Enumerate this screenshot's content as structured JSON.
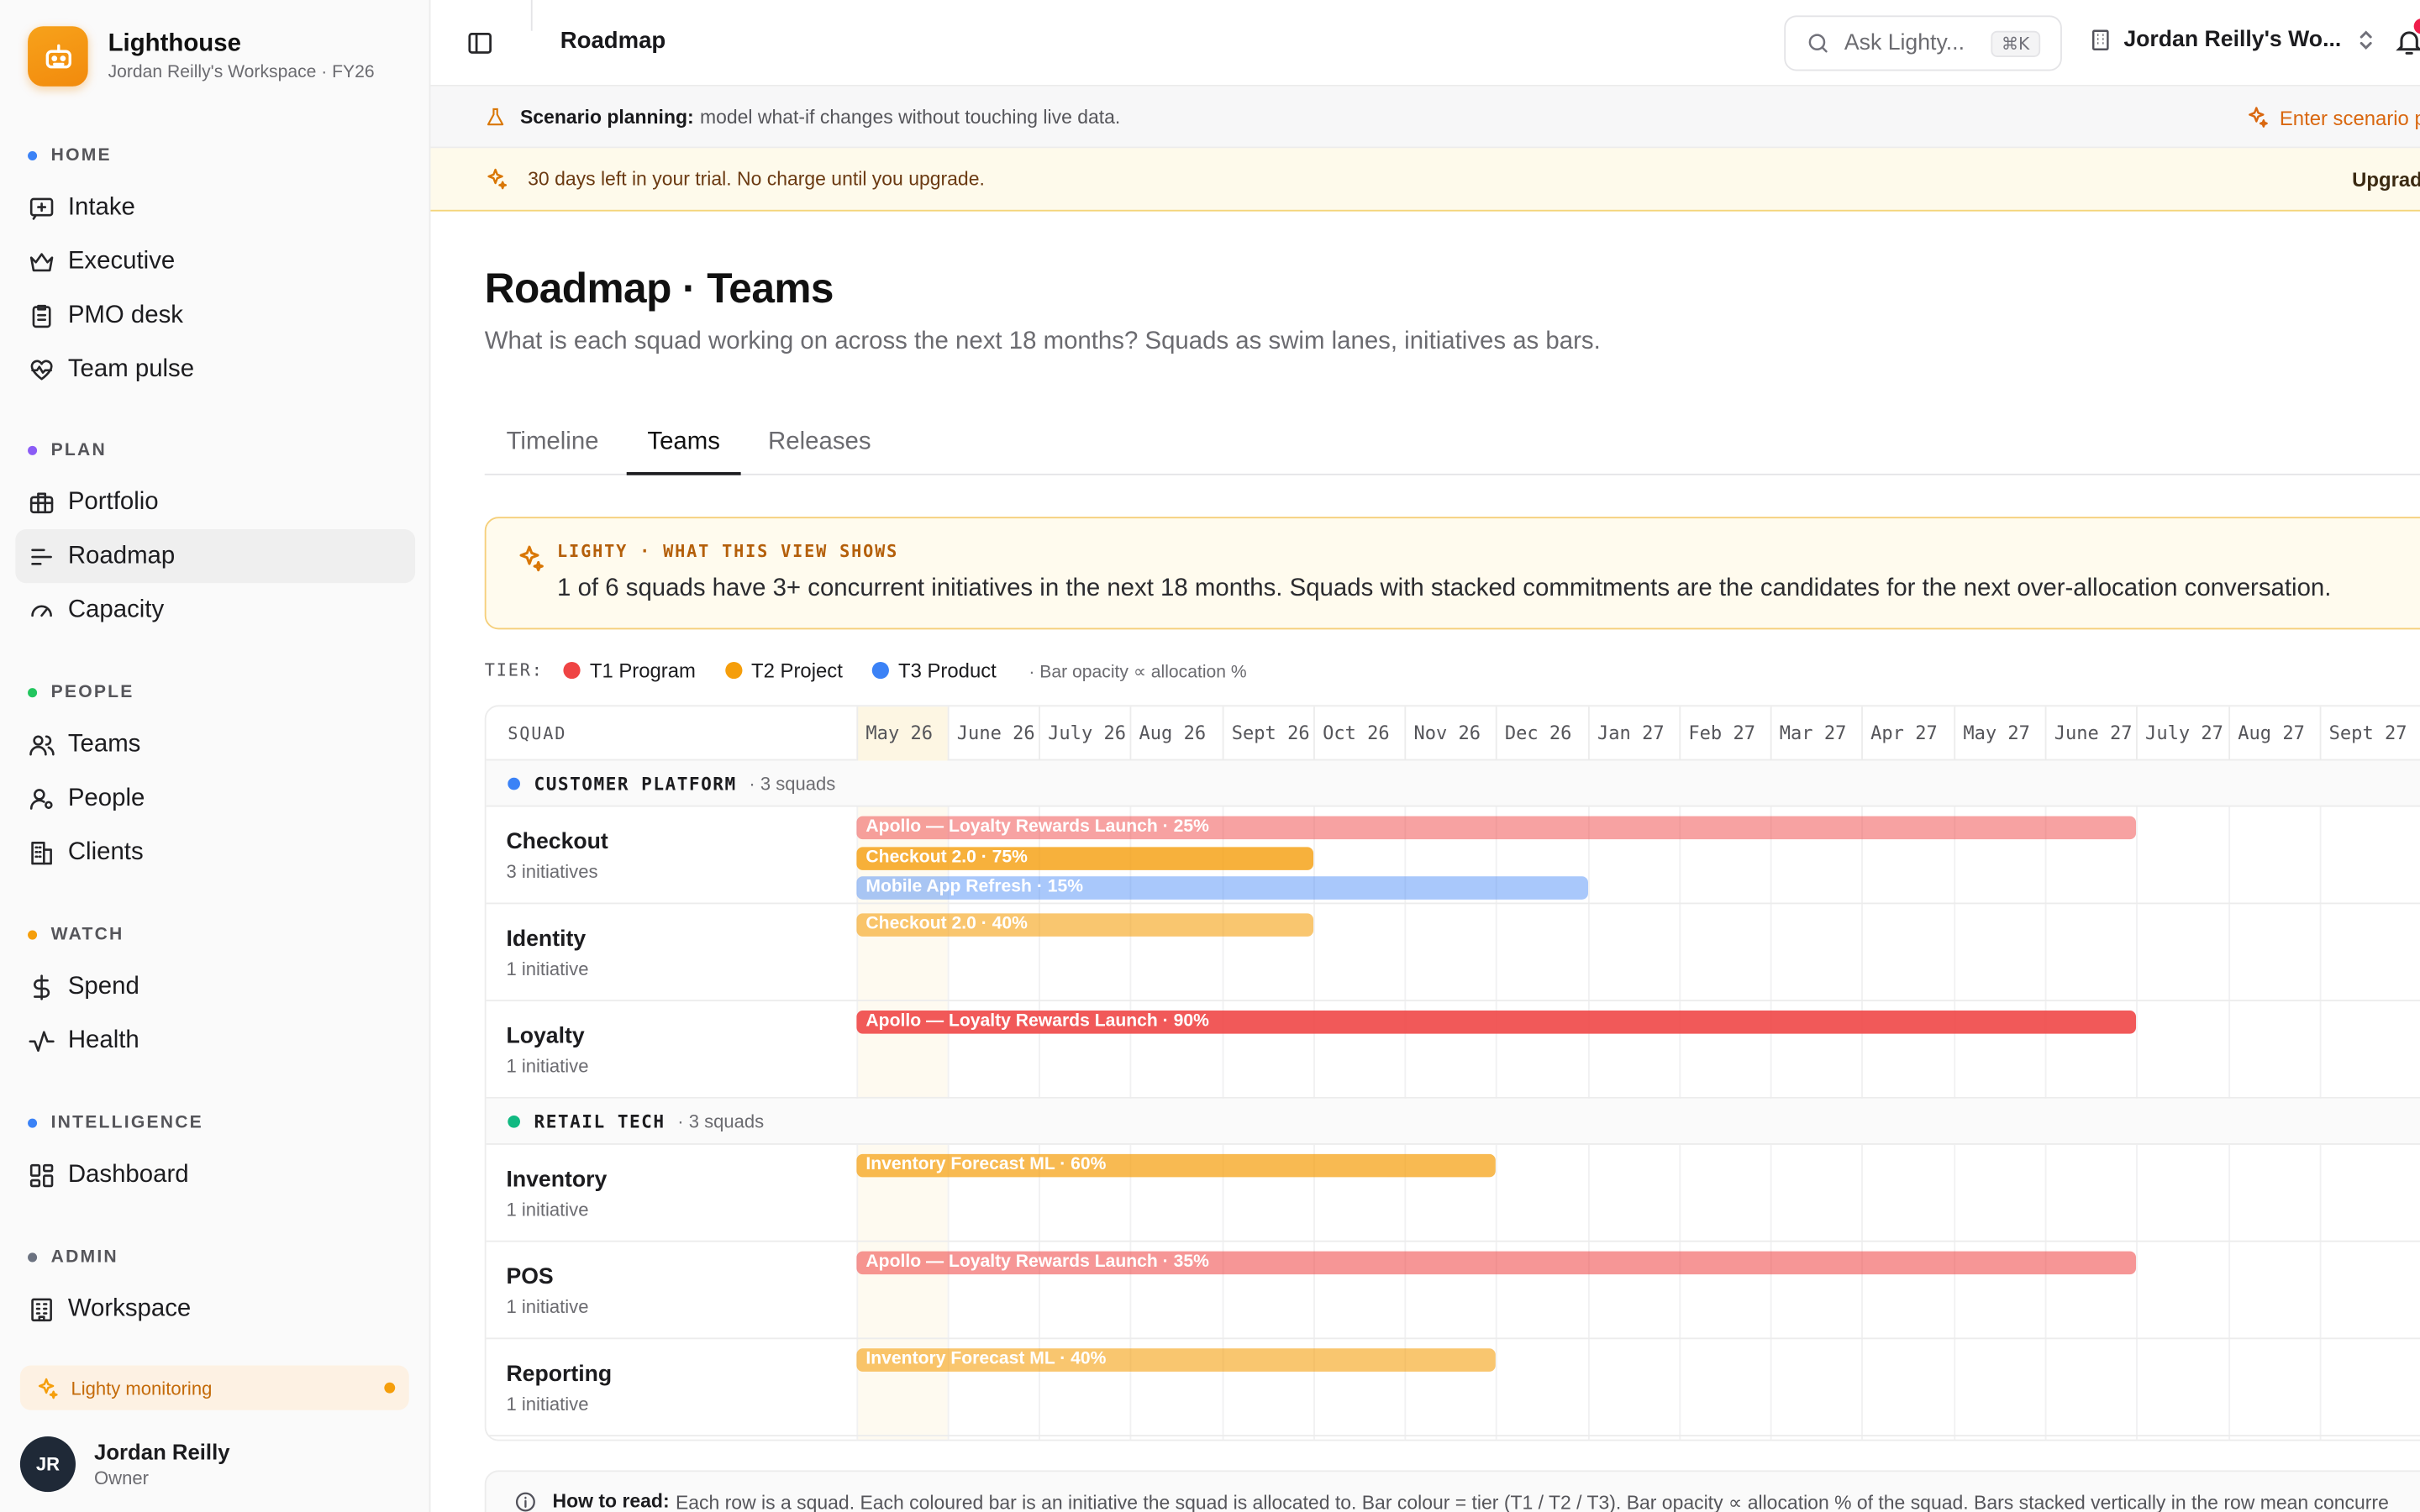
{
  "brand": {
    "name": "Lighthouse",
    "subtitle": "Jordan Reilly's Workspace · FY26"
  },
  "sidebar": {
    "groups": [
      {
        "label": "HOME",
        "color": "#3b82f6",
        "items": [
          {
            "label": "Intake",
            "icon": "inbox-plus-icon"
          },
          {
            "label": "Executive",
            "icon": "crown-icon"
          },
          {
            "label": "PMO desk",
            "icon": "clipboard-icon"
          },
          {
            "label": "Team pulse",
            "icon": "heart-pulse-icon"
          }
        ]
      },
      {
        "label": "PLAN",
        "color": "#8b5cf6",
        "items": [
          {
            "label": "Portfolio",
            "icon": "briefcase-icon"
          },
          {
            "label": "Roadmap",
            "icon": "roadmap-lines-icon",
            "active": true
          },
          {
            "label": "Capacity",
            "icon": "gauge-icon"
          }
        ]
      },
      {
        "label": "PEOPLE",
        "color": "#22c55e",
        "items": [
          {
            "label": "Teams",
            "icon": "users-icon"
          },
          {
            "label": "People",
            "icon": "user-cog-icon"
          },
          {
            "label": "Clients",
            "icon": "building-icon"
          }
        ]
      },
      {
        "label": "WATCH",
        "color": "#f59e0b",
        "items": [
          {
            "label": "Spend",
            "icon": "dollar-icon"
          },
          {
            "label": "Health",
            "icon": "activity-icon"
          }
        ]
      },
      {
        "label": "INTELLIGENCE",
        "color": "#3b82f6",
        "items": [
          {
            "label": "Dashboard",
            "icon": "dashboard-grid-icon"
          }
        ]
      },
      {
        "label": "ADMIN",
        "color": "#6b7280",
        "items": [
          {
            "label": "Workspace",
            "icon": "office-building-icon"
          }
        ]
      }
    ],
    "monitoring": "Lighty monitoring",
    "user": {
      "initials": "JR",
      "name": "Jordan Reilly",
      "role": "Owner"
    }
  },
  "header": {
    "breadcrumb": "Roadmap",
    "ask_placeholder": "Ask Lighty...",
    "ask_shortcut": "⌘K",
    "workspace": "Jordan Reilly's Wo..."
  },
  "scenario": {
    "title": "Scenario planning:",
    "text": "model what-if changes without touching live data.",
    "cta": "Enter scenario p"
  },
  "trial": {
    "text": "30 days left in your trial. No charge until you upgrade.",
    "cta": "Upgrad"
  },
  "page": {
    "title": "Roadmap · Teams",
    "subtitle": "What is each squad working on across the next 18 months? Squads as swim lanes, initiatives as bars.",
    "tabs": [
      "Timeline",
      "Teams",
      "Releases"
    ],
    "active_tab": "Teams"
  },
  "callout": {
    "label": "LIGHTY · WHAT THIS VIEW SHOWS",
    "text": "1 of 6 squads have 3+ concurrent initiatives in the next 18 months. Squads with stacked commitments are the candidates for the next over-allocation conversation."
  },
  "legend": {
    "label": "TIER:",
    "items": [
      {
        "label": "T1 Program",
        "color": "#ef4444"
      },
      {
        "label": "T2 Project",
        "color": "#f59e0b"
      },
      {
        "label": "T3 Product",
        "color": "#3b82f6"
      }
    ],
    "note": "· Bar opacity ∝ allocation %"
  },
  "roadmap": {
    "squad_header": "SQUAD",
    "months": [
      "May 26",
      "June 26",
      "July 26",
      "Aug 26",
      "Sept 26",
      "Oct 26",
      "Nov 26",
      "Dec 26",
      "Jan 27",
      "Feb 27",
      "Mar 27",
      "Apr 27",
      "May 27",
      "June 27",
      "July 27",
      "Aug 27",
      "Sept 27"
    ],
    "tier_colors": {
      "T1": "#ef4444",
      "T2": "#f59e0b",
      "T3": "#3b82f6"
    },
    "groups": [
      {
        "name": "CUSTOMER PLATFORM",
        "count": "· 3 squads",
        "color": "#3b82f6",
        "squads": [
          {
            "name": "Checkout",
            "count": "3 initiatives",
            "bars": [
              {
                "label": "Apollo — Loyalty Rewards Launch · 25%",
                "tier": "T1",
                "allocation": 25,
                "start": 0,
                "end": 14
              },
              {
                "label": "Checkout 2.0 · 75%",
                "tier": "T2",
                "allocation": 75,
                "start": 0,
                "end": 5
              },
              {
                "label": "Mobile App Refresh · 15%",
                "tier": "T3",
                "allocation": 15,
                "start": 0,
                "end": 8
              }
            ]
          },
          {
            "name": "Identity",
            "count": "1 initiative",
            "bars": [
              {
                "label": "Checkout 2.0 · 40%",
                "tier": "T2",
                "allocation": 40,
                "start": 0,
                "end": 5
              }
            ]
          },
          {
            "name": "Loyalty",
            "count": "1 initiative",
            "bars": [
              {
                "label": "Apollo — Loyalty Rewards Launch · 90%",
                "tier": "T1",
                "allocation": 90,
                "start": 0,
                "end": 14
              }
            ]
          }
        ]
      },
      {
        "name": "RETAIL TECH",
        "count": "· 3 squads",
        "color": "#10b981",
        "squads": [
          {
            "name": "Inventory",
            "count": "1 initiative",
            "bars": [
              {
                "label": "Inventory Forecast ML · 60%",
                "tier": "T2",
                "allocation": 60,
                "start": 0,
                "end": 7
              }
            ]
          },
          {
            "name": "POS",
            "count": "1 initiative",
            "bars": [
              {
                "label": "Apollo — Loyalty Rewards Launch · 35%",
                "tier": "T1",
                "allocation": 35,
                "start": 0,
                "end": 14
              }
            ]
          },
          {
            "name": "Reporting",
            "count": "1 initiative",
            "bars": [
              {
                "label": "Inventory Forecast ML · 40%",
                "tier": "T2",
                "allocation": 40,
                "start": 0,
                "end": 7
              }
            ]
          }
        ]
      }
    ]
  },
  "howto": {
    "title": "How to read:",
    "text": "Each row is a squad. Each coloured bar is an initiative the squad is allocated to. Bar colour = tier (T1 / T2 / T3). Bar opacity ∝ allocation % of the squad. Bars stacked vertically in the row mean concurre"
  }
}
